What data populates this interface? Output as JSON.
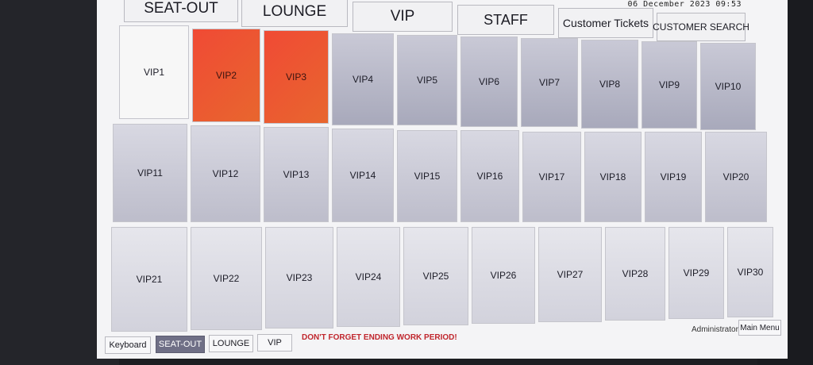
{
  "datetime": "06 December 2023 09:53",
  "top_tabs": [
    {
      "label": "SEAT-OUT"
    },
    {
      "label": "LOUNGE"
    },
    {
      "label": "VIP"
    },
    {
      "label": "STAFF"
    },
    {
      "label": "Customer Tickets"
    },
    {
      "label": "CUSTOMER SEARCH"
    }
  ],
  "tables": {
    "row1": [
      {
        "label": "VIP1",
        "status": "free"
      },
      {
        "label": "VIP2",
        "status": "busy"
      },
      {
        "label": "VIP3",
        "status": "busy"
      },
      {
        "label": "VIP4",
        "status": "empty"
      },
      {
        "label": "VIP5",
        "status": "empty"
      },
      {
        "label": "VIP6",
        "status": "empty"
      },
      {
        "label": "VIP7",
        "status": "empty"
      },
      {
        "label": "VIP8",
        "status": "empty"
      },
      {
        "label": "VIP9",
        "status": "empty"
      },
      {
        "label": "VIP10",
        "status": "empty"
      }
    ],
    "row2": [
      {
        "label": "VIP11"
      },
      {
        "label": "VIP12"
      },
      {
        "label": "VIP13"
      },
      {
        "label": "VIP14"
      },
      {
        "label": "VIP15"
      },
      {
        "label": "VIP16"
      },
      {
        "label": "VIP17"
      },
      {
        "label": "VIP18"
      },
      {
        "label": "VIP19"
      },
      {
        "label": "VIP20"
      }
    ],
    "row3": [
      {
        "label": "VIP21"
      },
      {
        "label": "VIP22"
      },
      {
        "label": "VIP23"
      },
      {
        "label": "VIP24"
      },
      {
        "label": "VIP25"
      },
      {
        "label": "VIP26"
      },
      {
        "label": "VIP27"
      },
      {
        "label": "VIP28"
      },
      {
        "label": "VIP29"
      },
      {
        "label": "VIP30"
      }
    ]
  },
  "bottom": {
    "buttons": [
      {
        "label": "Keyboard",
        "active": false
      },
      {
        "label": "SEAT-OUT",
        "active": true
      },
      {
        "label": "LOUNGE",
        "active": false
      },
      {
        "label": "VIP",
        "active": false
      }
    ],
    "warning": "DON'T FORGET ENDING WORK PERIOD!",
    "user": "Administrator",
    "main_menu": "Main Menu"
  },
  "colors": {
    "busy": "#f04a35",
    "active_button": "#6f6f86",
    "warning": "#c0262d"
  }
}
